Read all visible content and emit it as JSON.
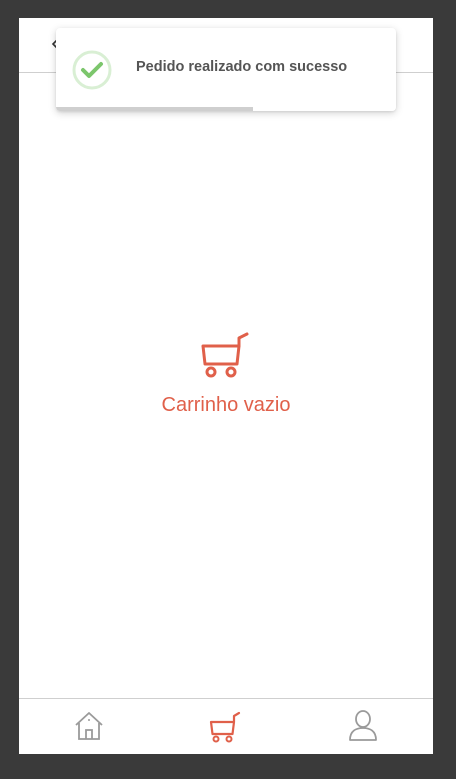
{
  "header": {
    "back_icon": "chevron-left-icon"
  },
  "toast": {
    "message": "Pedido realizado com sucesso",
    "icon": "check-circle-icon",
    "progress": 0.58,
    "colors": {
      "check": "#7cc66c",
      "ring": "#d9efd4",
      "progress": "#cfcfcf"
    }
  },
  "cart": {
    "empty_text": "Carrinho vazio",
    "icon": "shopping-cart-icon",
    "accent_color": "#e0604a"
  },
  "bottom_nav": {
    "items": [
      {
        "icon": "home-icon",
        "active": false
      },
      {
        "icon": "shopping-cart-icon",
        "active": true
      },
      {
        "icon": "user-icon",
        "active": false
      }
    ],
    "active_color": "#e0604a",
    "inactive_color": "#9a9a9a"
  }
}
